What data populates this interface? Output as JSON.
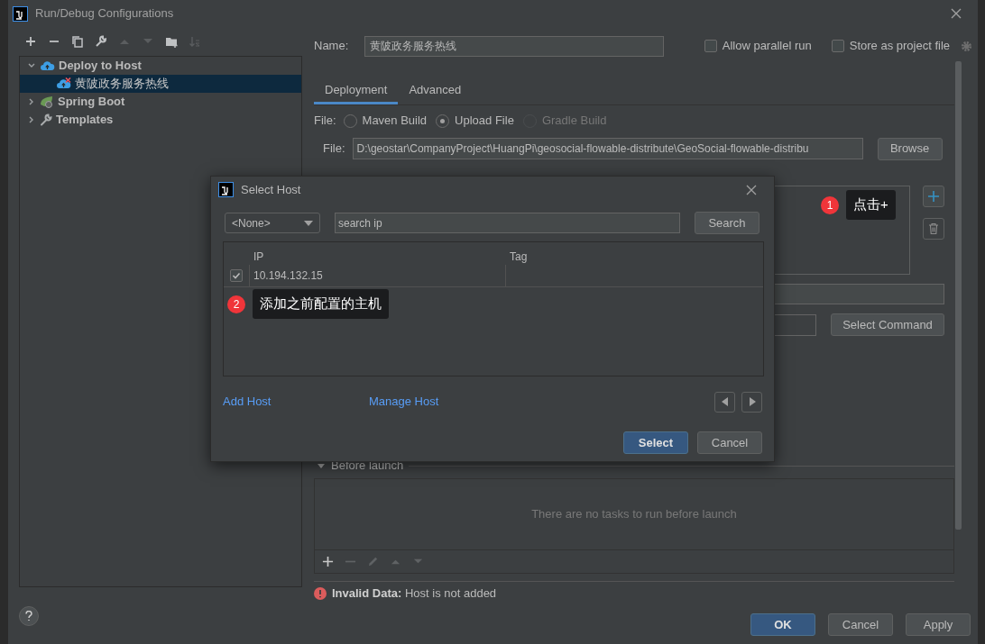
{
  "window": {
    "title": "Run/Debug Configurations"
  },
  "toolbar": [
    {
      "kind": "add",
      "disabled": false
    },
    {
      "kind": "remove",
      "disabled": false
    },
    {
      "kind": "copy",
      "disabled": false
    },
    {
      "kind": "edit",
      "disabled": false
    },
    {
      "kind": "up",
      "disabled": true
    },
    {
      "kind": "down",
      "disabled": true
    },
    {
      "kind": "folder",
      "disabled": false
    },
    {
      "kind": "sort",
      "disabled": true
    }
  ],
  "tree": [
    {
      "label": "Deploy to Host",
      "kind": "deploy",
      "expanded": true,
      "selected": false,
      "children": [
        {
          "label": "黄陂政务服务热线",
          "kind": "deploy-error",
          "selected": true
        }
      ]
    },
    {
      "label": "Spring Boot",
      "kind": "spring",
      "expanded": false,
      "selected": false
    },
    {
      "label": "Templates",
      "kind": "templates",
      "expanded": false,
      "selected": false
    }
  ],
  "name_field": {
    "label": "Name:",
    "value": "黄陂政务服务热线"
  },
  "options": [
    {
      "label": "Allow parallel run",
      "checked": false
    },
    {
      "label": "Store as project file",
      "checked": false
    }
  ],
  "tabs": [
    {
      "label": "Deployment",
      "selected": true
    },
    {
      "label": "Advanced",
      "selected": false
    }
  ],
  "file_type": {
    "label": "File:",
    "options": [
      {
        "label": "Maven Build",
        "selected": false,
        "disabled": false
      },
      {
        "label": "Upload File",
        "selected": true,
        "disabled": false
      },
      {
        "label": "Gradle Build",
        "selected": false,
        "disabled": true
      }
    ]
  },
  "file_path": {
    "label": "File:",
    "value": "D:\\geostar\\CompanyProject\\HuangPi\\geosocial-flowable-distribute\\GeoSocial-flowable-distribu",
    "button": "Browse"
  },
  "select_command_button": "Select Command",
  "before_launch": {
    "label": "Before launch",
    "expanded": true,
    "empty_text": "There are no tasks to run before launch"
  },
  "error": {
    "title": "Invalid Data:",
    "message": "Host is not added"
  },
  "footer_buttons": [
    {
      "label": "OK",
      "default": true
    },
    {
      "label": "Cancel",
      "default": false
    },
    {
      "label": "Apply",
      "default": false
    }
  ],
  "select_host": {
    "title": "Select Host",
    "filter": "<None>",
    "search_value": "search ip",
    "search_button": "Search",
    "columns": [
      "IP",
      "Tag"
    ],
    "rows": [
      {
        "checked": true,
        "ip": "10.194.132.15"
      }
    ],
    "links": [
      "Add Host",
      "Manage Host"
    ],
    "buttons": [
      {
        "label": "Select",
        "default": true
      },
      {
        "label": "Cancel",
        "default": false
      }
    ]
  },
  "callouts": [
    {
      "number": "1",
      "text": "点击+"
    },
    {
      "number": "2",
      "text": "添加之前配置的主机"
    }
  ]
}
